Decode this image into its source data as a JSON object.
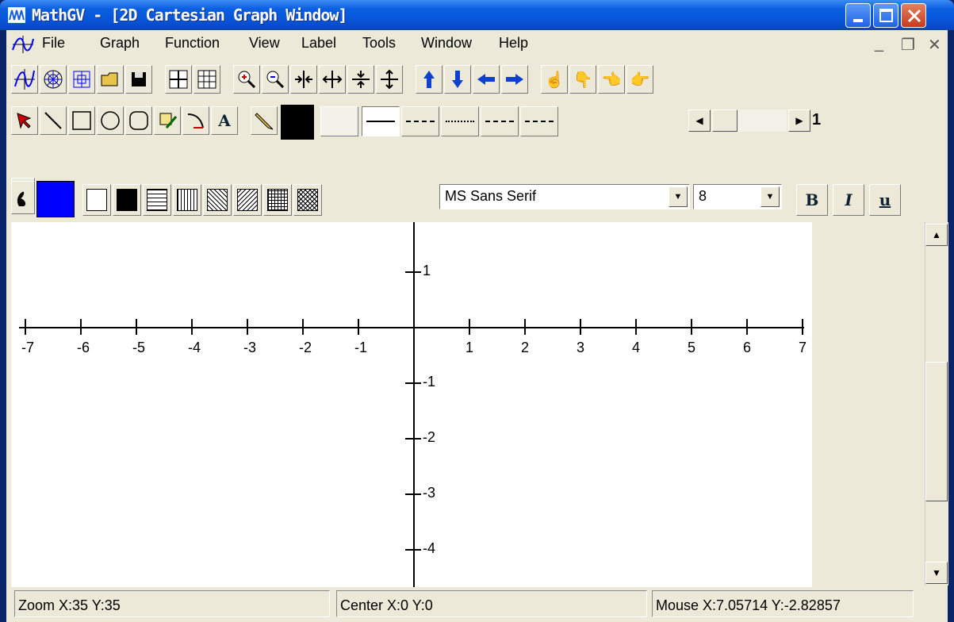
{
  "window": {
    "title": "MathGV - [2D Cartesian Graph Window]",
    "controls": [
      "minimize",
      "maximize",
      "close"
    ]
  },
  "menubar": {
    "items": [
      "File",
      "Graph",
      "Function",
      "View",
      "Label",
      "Tools",
      "Window",
      "Help"
    ],
    "mdi_controls": [
      "_",
      "❐",
      "✕"
    ]
  },
  "toolbar1": {
    "buttons": [
      "2d-graph-icon",
      "polar-graph-icon",
      "3d-graph-icon",
      "open-folder-icon",
      "save-icon",
      "grid-icon",
      "grid-labels-icon",
      "zoom-in-icon",
      "zoom-out-icon",
      "x-shrink-icon",
      "x-expand-icon",
      "y-shrink-icon",
      "y-expand-icon",
      "pan-up-icon",
      "pan-down-icon",
      "pan-left-icon",
      "pan-right-icon",
      "hand-up-icon",
      "hand-down-icon",
      "hand-left-icon",
      "hand-right-icon"
    ]
  },
  "toolbar2": {
    "tools": [
      "select-arrow-icon",
      "line-icon",
      "rectangle-icon",
      "ellipse-icon",
      "rounded-rect-icon",
      "pen-edit-icon",
      "curve-icon",
      "text-tool-icon",
      "pencil-icon"
    ],
    "text_tool_label": "A",
    "color": "#000000",
    "line_width_value": "1"
  },
  "toolbar3": {
    "fill_color": "#0000ff",
    "font_name": "MS Sans Serif",
    "font_size": "8",
    "bold_label": "B",
    "italic_label": "I",
    "underline_label": "u"
  },
  "graph": {
    "x_ticks": [
      "-7",
      "-6",
      "-5",
      "-4",
      "-3",
      "-2",
      "-1",
      "1",
      "2",
      "3",
      "4",
      "5",
      "6",
      "7"
    ],
    "y_ticks": [
      "1",
      "-1",
      "-2",
      "-3",
      "-4"
    ],
    "x_range": [
      -7,
      7
    ],
    "y_range": [
      -4.5,
      2
    ]
  },
  "status": {
    "zoom": "Zoom X:35 Y:35",
    "center": "Center X:0 Y:0",
    "mouse": "Mouse X:7.05714 Y:-2.82857"
  }
}
